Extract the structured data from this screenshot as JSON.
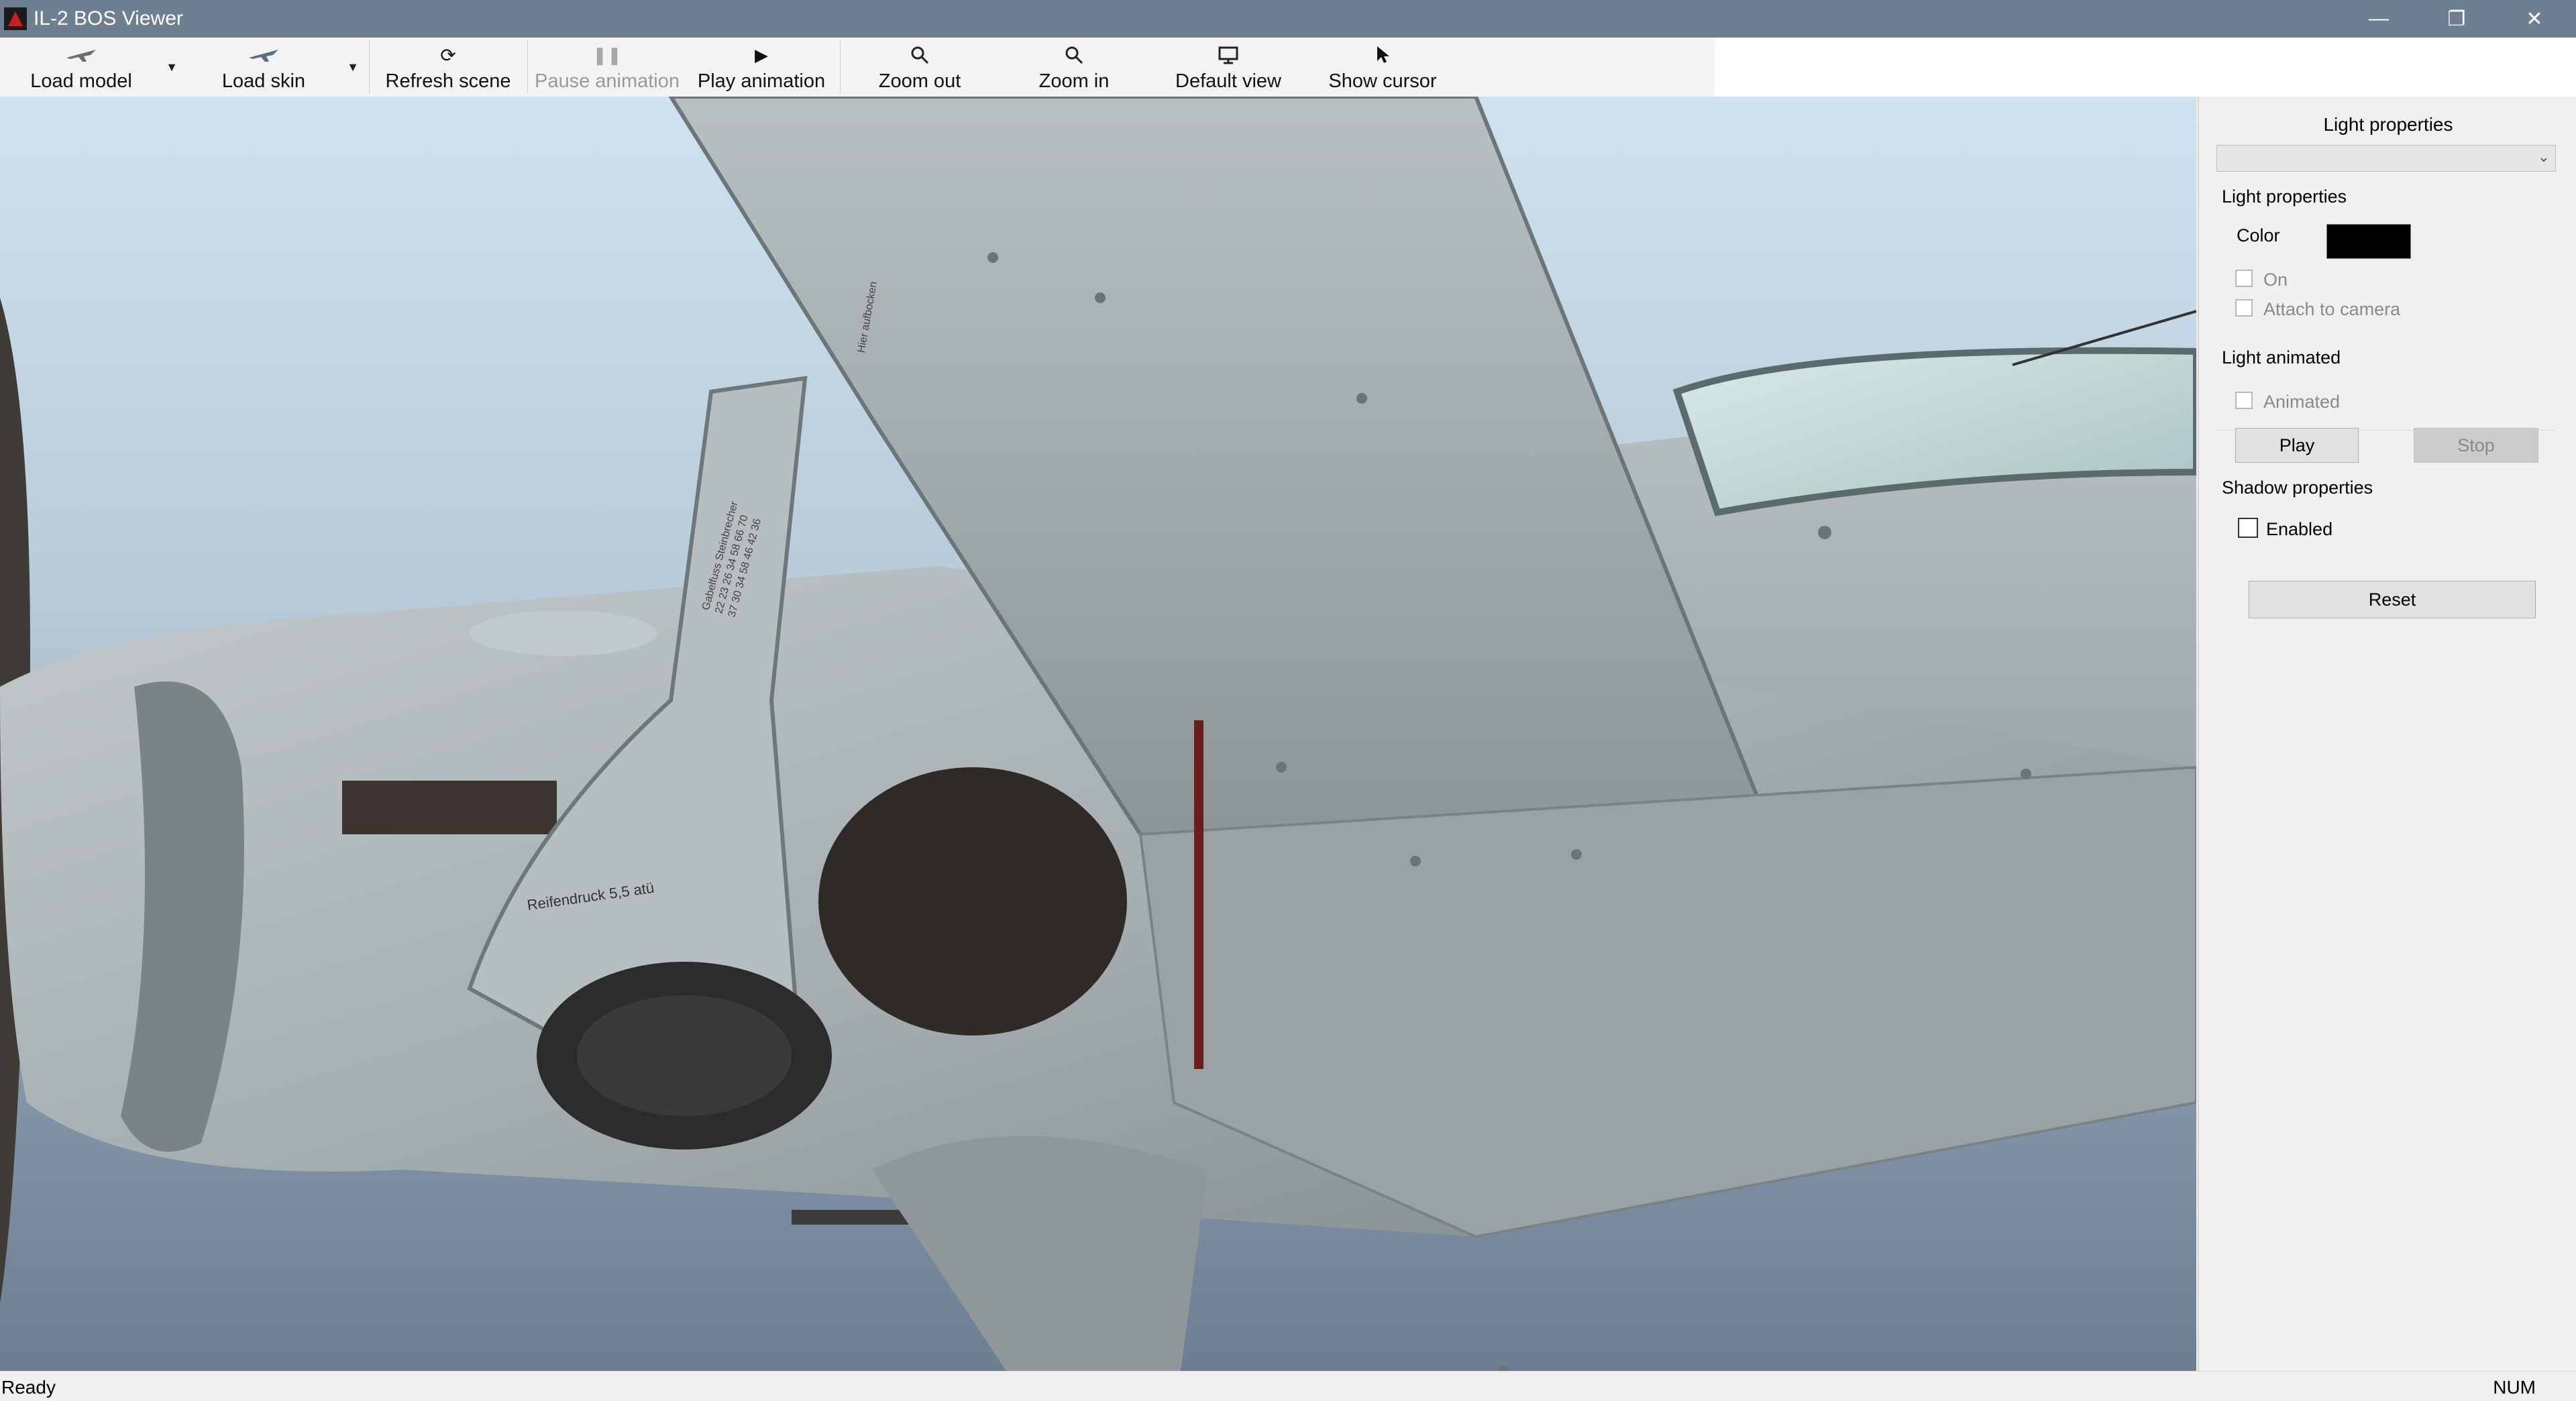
{
  "window": {
    "title": "IL-2 BOS Viewer"
  },
  "toolbar": {
    "load_model": "Load model",
    "load_skin": "Load skin",
    "refresh_scene": "Refresh scene",
    "pause_animation": "Pause animation",
    "play_animation": "Play animation",
    "zoom_out": "Zoom out",
    "zoom_in": "Zoom in",
    "default_view": "Default view",
    "show_cursor": "Show cursor"
  },
  "viewport": {
    "stencils": {
      "tire": "Reifendruck 5,5 atü",
      "leg_block": "Gabelfuss Steinbrecher\n22 23 26 34 58 66 70\n37 30 34 58 46 42 36",
      "rear": "Hier aufbocken"
    }
  },
  "panel": {
    "title": "Light properties",
    "dropdown_value": "",
    "light_group": {
      "title": "Light properties",
      "color_label": "Color",
      "on_label": "On",
      "attach_label": "Attach to camera",
      "color_value": "#000000"
    },
    "animated_group": {
      "title": "Light animated",
      "animated_label": "Animated",
      "play": "Play",
      "stop": "Stop"
    },
    "shadow_group": {
      "title": "Shadow properties",
      "enabled_label": "Enabled"
    },
    "reset": "Reset"
  },
  "status": {
    "text": "Ready",
    "num": "NUM"
  },
  "colors": {
    "titlebar": "#6f7f92",
    "panel": "#f0f0f0",
    "sky_top": "#cfe2ef",
    "sky_bottom": "#6c7f92",
    "metal": "#a9b1b3"
  }
}
